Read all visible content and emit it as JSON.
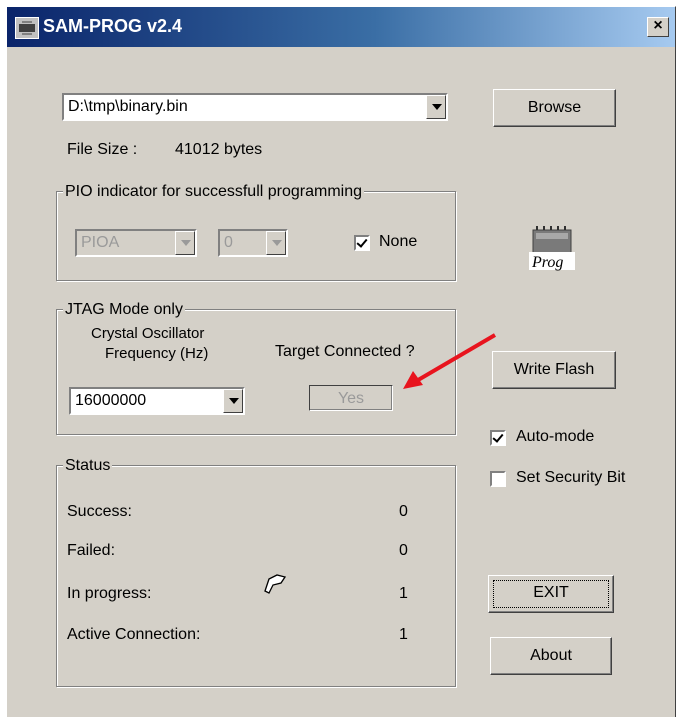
{
  "window": {
    "title": "SAM-PROG v2.4",
    "close_glyph": "×"
  },
  "file": {
    "path": "D:\\tmp\\binary.bin",
    "size_label": "File Size :",
    "size_value": "41012 bytes",
    "browse_label": "Browse"
  },
  "pio": {
    "group_title": "PIO indicator for successfull programming",
    "port": "PIOA",
    "pin": "0",
    "none_label": "None",
    "none_checked": true
  },
  "jtag": {
    "group_title": "JTAG Mode only",
    "crystal_label_line1": "Crystal Oscillator",
    "crystal_label_line2": "Frequency (Hz)",
    "frequency": "16000000",
    "target_label": "Target Connected ?",
    "target_button": "Yes"
  },
  "actions": {
    "write_flash": "Write Flash",
    "auto_mode": "Auto-mode",
    "auto_mode_checked": true,
    "security_bit": "Set Security Bit",
    "security_bit_checked": false,
    "exit": "EXIT",
    "about": "About"
  },
  "status": {
    "group_title": "Status",
    "rows": [
      {
        "label": "Success:",
        "value": "0"
      },
      {
        "label": "Failed:",
        "value": "0"
      },
      {
        "label": "In progress:",
        "value": "1"
      },
      {
        "label": "Active Connection:",
        "value": "1"
      }
    ]
  },
  "prog_icon": {
    "text": "Prog",
    "icon": "chip-prog-icon"
  },
  "annotation": {
    "arrow_color": "#e8141e"
  }
}
